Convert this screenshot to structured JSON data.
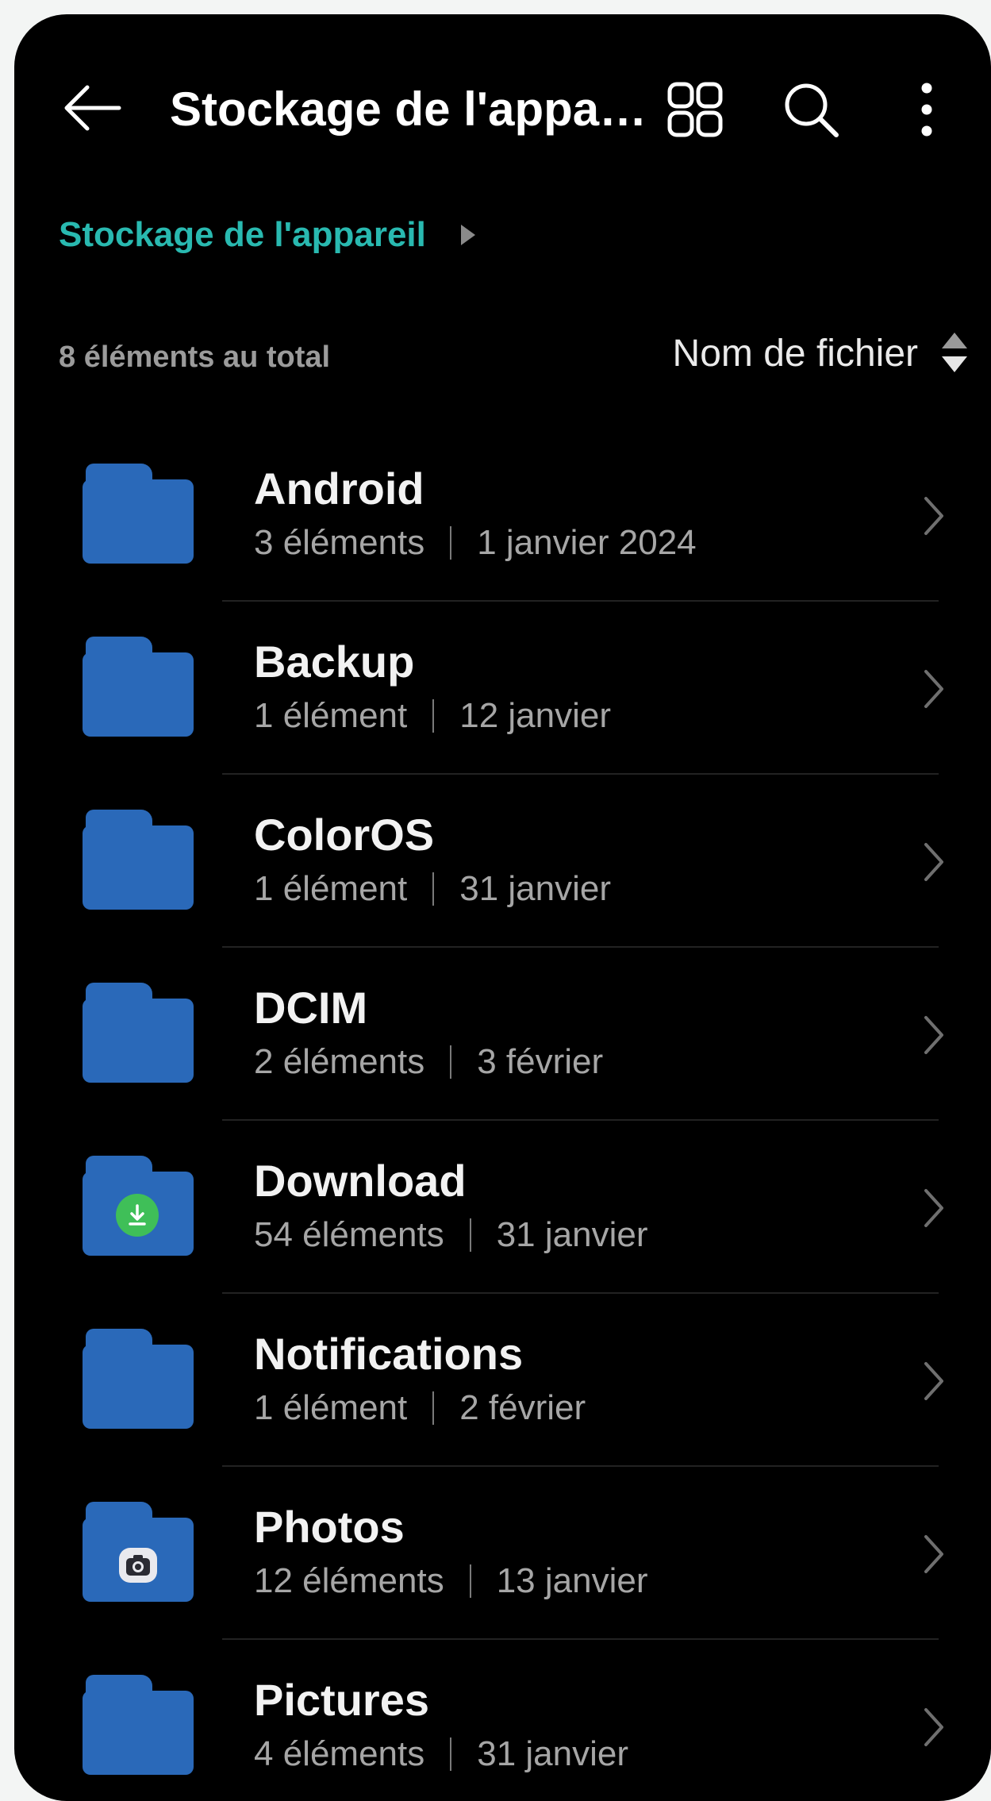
{
  "header": {
    "title": "Stockage de l'appar...",
    "back_icon": "arrow-left-icon",
    "grid_icon": "grid-view-icon",
    "search_icon": "search-icon",
    "more_icon": "more-vertical-icon"
  },
  "breadcrumb": {
    "label": "Stockage de l'appareil"
  },
  "summary": {
    "total": "8 éléments au total",
    "sort_label": "Nom de fichier"
  },
  "colors": {
    "accent": "#29b9b0",
    "folder": "#2a69b9",
    "download_badge": "#3fbf58"
  },
  "folders": [
    {
      "name": "Android",
      "count": "3 éléments",
      "date": "1 janvier 2024",
      "icon": "folder-icon"
    },
    {
      "name": "Backup",
      "count": "1 élément",
      "date": "12 janvier",
      "icon": "folder-icon"
    },
    {
      "name": "ColorOS",
      "count": "1 élément",
      "date": "31 janvier",
      "icon": "folder-icon"
    },
    {
      "name": "DCIM",
      "count": "2 éléments",
      "date": "3 février",
      "icon": "folder-icon"
    },
    {
      "name": "Download",
      "count": "54 éléments",
      "date": "31 janvier",
      "icon": "download-folder-icon"
    },
    {
      "name": "Notifications",
      "count": "1 élément",
      "date": "2 février",
      "icon": "folder-icon"
    },
    {
      "name": "Photos",
      "count": "12 éléments",
      "date": "13 janvier",
      "icon": "photos-folder-icon"
    },
    {
      "name": "Pictures",
      "count": "4 éléments",
      "date": "31 janvier",
      "icon": "folder-icon"
    }
  ]
}
